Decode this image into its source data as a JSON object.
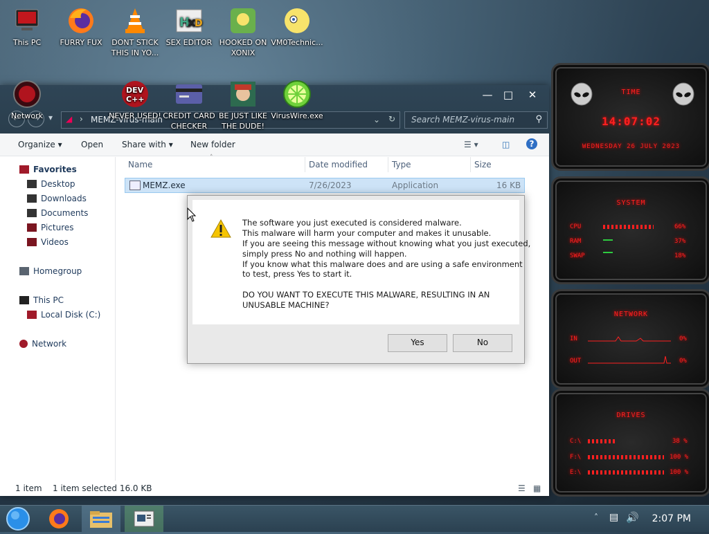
{
  "desktop": {
    "icons": [
      {
        "label": "This PC",
        "icon": "computer-icon"
      },
      {
        "label": "FURRY FUX",
        "icon": "firefox-icon"
      },
      {
        "label": "DONT STICK THIS IN YO...",
        "icon": "vlc-icon"
      },
      {
        "label": "SEX EDITOR",
        "icon": "hxd-icon"
      },
      {
        "label": "HOOKED ON XONIX",
        "icon": "game-icon"
      },
      {
        "label": "VM0Technic...",
        "icon": "anime-icon"
      },
      {
        "label": "Network",
        "icon": "network-icon"
      },
      {
        "label": "NEVER USED!",
        "icon": "devcpp-icon"
      },
      {
        "label": "CREDIT CARD CHECKER",
        "icon": "card-icon"
      },
      {
        "label": "BE JUST LIKE THE DUDE!",
        "icon": "dude-icon"
      },
      {
        "label": "VirusWire.exe",
        "icon": "limewire-icon"
      }
    ]
  },
  "explorer": {
    "breadcrumb": "MEMZ-virus-main",
    "search_placeholder": "Search MEMZ-virus-main",
    "toolbar": {
      "organize": "Organize",
      "open": "Open",
      "share_with": "Share with",
      "new_folder": "New folder"
    },
    "nav": {
      "favorites": "Favorites",
      "desktop": "Desktop",
      "downloads": "Downloads",
      "documents": "Documents",
      "pictures": "Pictures",
      "videos": "Videos",
      "homegroup": "Homegroup",
      "this_pc": "This PC",
      "local_disk": "Local Disk (C:)",
      "network": "Network"
    },
    "columns": {
      "name": "Name",
      "date": "Date modified",
      "type": "Type",
      "size": "Size"
    },
    "files": [
      {
        "name": "MEMZ.exe",
        "date": "7/26/2023",
        "type": "Application",
        "size": "16 KB"
      }
    ],
    "status": {
      "count": "1 item",
      "selected": "1 item selected  16.0 KB"
    }
  },
  "dialog": {
    "lines": [
      "The software you just executed is considered malware.",
      "This malware will harm your computer and makes it unusable.",
      "If you are seeing this message without knowing what you just executed,",
      "simply press No and nothing will happen.",
      "If you know what this malware does and are using a safe environment",
      "to test, press Yes to start it."
    ],
    "question_1": "DO YOU WANT TO EXECUTE THIS MALWARE, RESULTING IN AN",
    "question_2": "UNUSABLE MACHINE?",
    "yes": "Yes",
    "no": "No"
  },
  "gadgets": {
    "time": {
      "title": "TIME",
      "clock": "14:07:02",
      "date": "WEDNESDAY 26 JULY 2023"
    },
    "system": {
      "title": "SYSTEM",
      "cpu_label": "CPU",
      "cpu_value": "66%",
      "cpu_level": 0.66,
      "ram_label": "RAM",
      "ram_value": "37%",
      "ram_level": 0.37,
      "swap_label": "SWAP",
      "swap_value": "18%",
      "swap_level": 0.18
    },
    "network": {
      "title": "NETWORK",
      "in_label": "IN",
      "in_value": "0%",
      "out_label": "OUT",
      "out_value": "0%"
    },
    "drives": {
      "title": "DRIVES",
      "c_label": "C:\\",
      "c_value": "38 %",
      "c_level": 0.38,
      "f_label": "F:\\",
      "f_value": "100 %",
      "f_level": 1.0,
      "e_label": "E:\\",
      "e_value": "100 %",
      "e_level": 1.0
    }
  },
  "taskbar": {
    "clock": "2:07 PM",
    "items": [
      "start-orb",
      "firefox",
      "file-explorer",
      "app"
    ]
  }
}
